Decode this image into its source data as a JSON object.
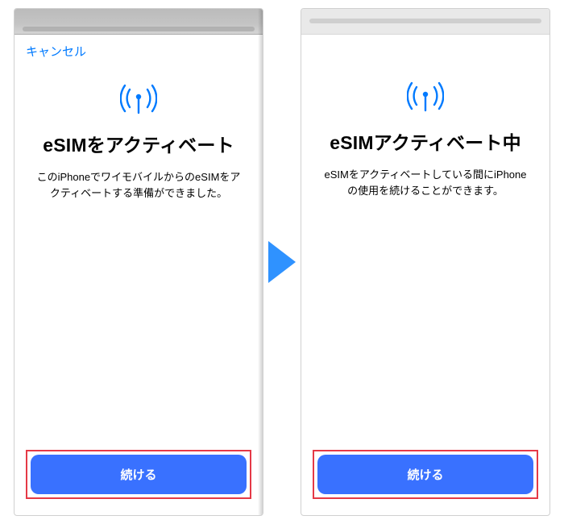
{
  "colors": {
    "accent": "#007aff",
    "button": "#3971ff",
    "highlight_border": "#e53946"
  },
  "screens": {
    "left": {
      "cancel_label": "キャンセル",
      "icon": "cellular-signal-icon",
      "title": "eSIMをアクティベート",
      "description": "このiPhoneでワイモバイルからのeSIMをアクティベートする準備ができました。",
      "primary_button": "続ける"
    },
    "right": {
      "icon": "cellular-signal-icon",
      "title": "eSIMアクティベート中",
      "description": "eSIMをアクティベートしている間にiPhoneの使用を続けることができます。",
      "primary_button": "続ける"
    }
  },
  "arrow": {
    "direction": "right"
  }
}
